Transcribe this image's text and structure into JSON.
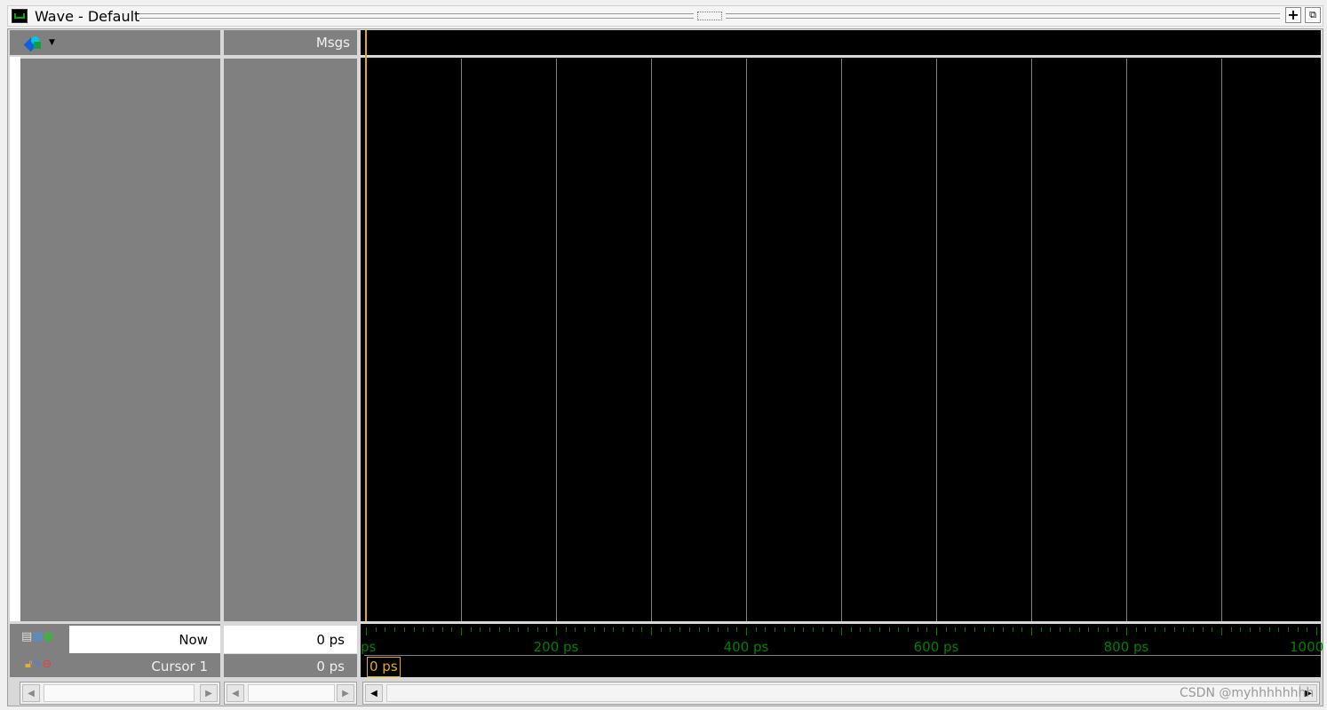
{
  "window": {
    "title": "Wave - Default",
    "icon": "wave-window-icon"
  },
  "header": {
    "msgs_label": "Msgs",
    "toolbar_icon": "wave-palette-icon"
  },
  "footer": {
    "now_label": "Now",
    "now_value": "0 ps",
    "cursor_label": "Cursor 1",
    "cursor_value": "0 ps",
    "cursor_marker": "0 ps"
  },
  "timeline": {
    "labels": [
      "ps",
      "200 ps",
      "400 ps",
      "600 ps",
      "800 ps",
      "1000"
    ],
    "ticks_ps": [
      0,
      200,
      400,
      600,
      800,
      1000
    ],
    "range_ps": [
      0,
      1000
    ],
    "grid_ps": 100,
    "cursor_ps": 0,
    "cursor_color": "#e0b000",
    "tick_color": "#008000"
  },
  "watermark": "CSDN @myhhhhhhhh"
}
